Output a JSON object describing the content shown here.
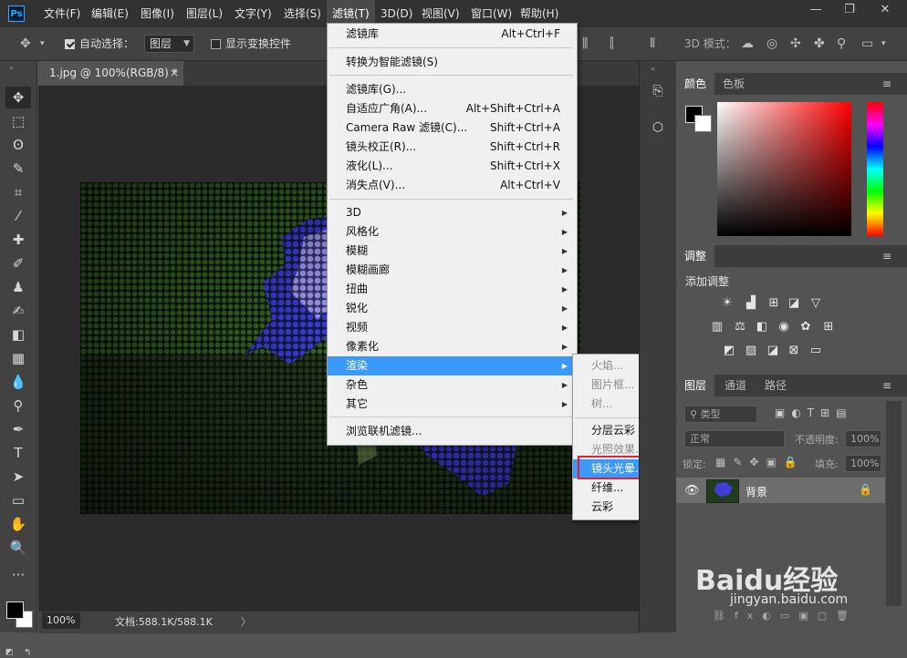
{
  "menubar": {
    "logo": "Ps",
    "items": [
      "文件(F)",
      "编辑(E)",
      "图像(I)",
      "图层(L)",
      "文字(Y)",
      "选择(S)",
      "滤镜(T)",
      "3D(D)",
      "视图(V)",
      "窗口(W)",
      "帮助(H)"
    ],
    "active_item": "滤镜(T)",
    "window_controls": [
      "—",
      "❐",
      "✕"
    ]
  },
  "options": {
    "auto_select_label": "自动选择：",
    "auto_select_value": "图层",
    "show_transform_label": "显示变换控件",
    "mode_3d_label": "3D 模式："
  },
  "document": {
    "tab_title": "1.jpg @ 100%(RGB/8) *",
    "close_glyph": "×",
    "zoom": "100%",
    "doc_size": "文档:588.1K/588.1K",
    "status_arrow": "〉"
  },
  "filter_menu": {
    "items": [
      {
        "label": "滤镜库",
        "shortcut": "Alt+Ctrl+F"
      },
      {
        "label": "转换为智能滤镜(S)"
      },
      {
        "label": "滤镜库(G)..."
      },
      {
        "label": "自适应广角(A)...",
        "shortcut": "Alt+Shift+Ctrl+A"
      },
      {
        "label": "Camera Raw 滤镜(C)...",
        "shortcut": "Shift+Ctrl+A"
      },
      {
        "label": "镜头校正(R)...",
        "shortcut": "Shift+Ctrl+R"
      },
      {
        "label": "液化(L)...",
        "shortcut": "Shift+Ctrl+X"
      },
      {
        "label": "消失点(V)...",
        "shortcut": "Alt+Ctrl+V"
      },
      {
        "label": "3D"
      },
      {
        "label": "风格化"
      },
      {
        "label": "模糊"
      },
      {
        "label": "模糊画廊"
      },
      {
        "label": "扭曲"
      },
      {
        "label": "锐化"
      },
      {
        "label": "视频"
      },
      {
        "label": "像素化"
      },
      {
        "label": "渲染"
      },
      {
        "label": "杂色"
      },
      {
        "label": "其它"
      },
      {
        "label": "浏览联机滤镜..."
      }
    ]
  },
  "render_submenu": {
    "items": [
      "火焰...",
      "图片框...",
      "树...",
      "分层云彩",
      "光照效果...",
      "镜头光晕...",
      "纤维...",
      "云彩"
    ]
  },
  "panels": {
    "color_tabs": [
      "颜色",
      "色板"
    ],
    "adjust_tab": "调整",
    "add_adjustment": "添加调整",
    "layer_tabs": [
      "图层",
      "通道",
      "路径"
    ],
    "kind_filter": "类型",
    "blend_mode": "正常",
    "opacity_label": "不透明度:",
    "opacity_value": "100%",
    "lock_label": "锁定:",
    "fill_label": "填充:",
    "fill_value": "100%",
    "layer_name": "背景",
    "footer_fx": "fx"
  },
  "watermark": {
    "brand": "Baidu经验",
    "url": "jingyan.baidu.com"
  },
  "colors": {
    "menu_highlight": "#3c99fc",
    "selection_box": "#e8212d"
  }
}
